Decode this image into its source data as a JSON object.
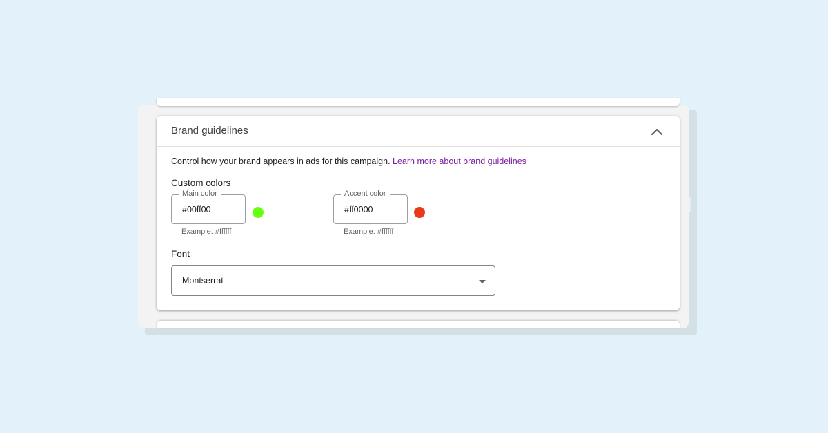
{
  "panel": {
    "title": "Brand guidelines",
    "collapse_icon": "chevron-up-icon",
    "description": "Control how your brand appears in ads for this campaign.",
    "learn_more_link": "Learn more about brand guidelines"
  },
  "custom_colors": {
    "heading": "Custom colors",
    "main": {
      "label": "Main color",
      "value": "#00ff00",
      "display_value": "#00ff00",
      "helper": "Example: #ffffff",
      "swatch_color": "#66ff12"
    },
    "accent": {
      "label": "Accent color",
      "value": "#ff0000",
      "display_value": "#ff0000",
      "helper": "Example: #ffffff",
      "swatch_color": "#e8391b"
    }
  },
  "font": {
    "heading": "Font",
    "selected": "Montserrat",
    "dropdown_icon": "arrow-drop-down-icon"
  },
  "colors": {
    "page_background": "#e2f1fa",
    "link": "#7b1fa2"
  }
}
